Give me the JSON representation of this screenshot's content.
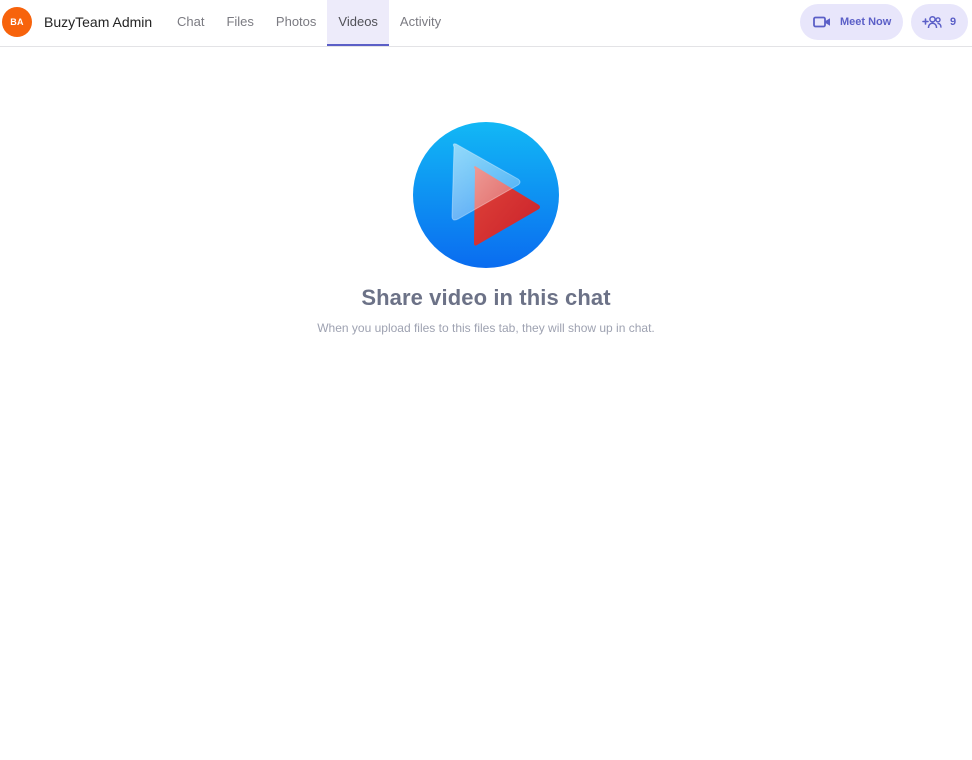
{
  "header": {
    "avatar": {
      "initials": "BA",
      "color": "#f7630c"
    },
    "title": "BuzyTeam Admin",
    "tabs": [
      {
        "label": "Chat",
        "active": false
      },
      {
        "label": "Files",
        "active": false
      },
      {
        "label": "Photos",
        "active": false
      },
      {
        "label": "Videos",
        "active": true
      },
      {
        "label": "Activity",
        "active": false
      }
    ],
    "meet_now": {
      "label": "Meet Now",
      "icon": "video-camera-icon"
    },
    "participants": {
      "count": "9",
      "icon": "add-people-icon"
    }
  },
  "empty_state": {
    "icon": "video-play-icon",
    "title": "Share video in this chat",
    "subtitle": "When you upload files to this files tab, they will show up in chat."
  },
  "colors": {
    "accent": "#5b5fc7",
    "accent_light": "#e8e6fb",
    "tab_active_bg": "#edebfa",
    "divider": "#e3e3e6"
  }
}
